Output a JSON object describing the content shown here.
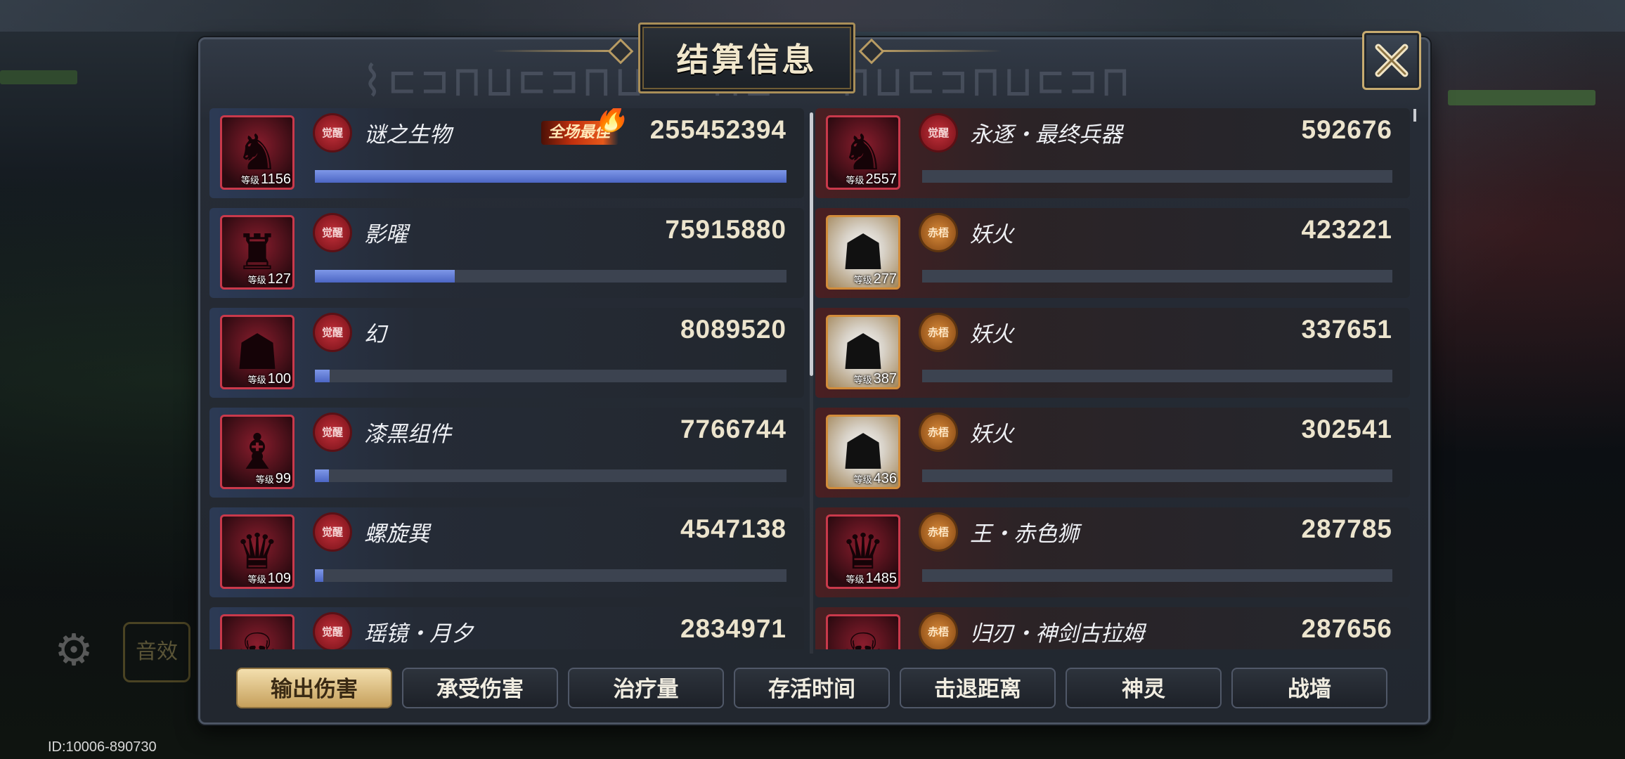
{
  "player_id": "ID:10006-890730",
  "dialog": {
    "title": "结算信息",
    "close_label": "close"
  },
  "background": {
    "gear_icon": "gear-icon",
    "side_button_label": "音效"
  },
  "left_team": [
    {
      "name": "谜之生物",
      "level_label": "等级",
      "level": "1156",
      "value": "255452394",
      "progress": 1.0,
      "badge": "觉醒",
      "mvp": "全场最佳"
    },
    {
      "name": "影曜",
      "level_label": "等级",
      "level": "127",
      "value": "75915880",
      "progress": 0.297,
      "badge": "觉醒"
    },
    {
      "name": "幻",
      "level_label": "等级",
      "level": "100",
      "value": "8089520",
      "progress": 0.032,
      "badge": "觉醒"
    },
    {
      "name": "漆黑组件",
      "level_label": "等级",
      "level": "99",
      "value": "7766744",
      "progress": 0.03,
      "badge": "觉醒"
    },
    {
      "name": "螺旋巽",
      "level_label": "等级",
      "level": "109",
      "value": "4547138",
      "progress": 0.018,
      "badge": "觉醒"
    },
    {
      "name": "瑶镜・月夕",
      "level_label": "等级",
      "level": "",
      "value": "2834971",
      "progress": 0.011,
      "badge": "觉醒"
    }
  ],
  "right_team": [
    {
      "name": "永逐・最终兵器",
      "level_label": "等级",
      "level": "2557",
      "value": "592676",
      "progress": 0.0,
      "badge": "觉醒",
      "style": "red"
    },
    {
      "name": "妖火",
      "level_label": "等级",
      "level": "277",
      "value": "423221",
      "progress": 0.0,
      "badge": "赤梧",
      "style": "gold"
    },
    {
      "name": "妖火",
      "level_label": "等级",
      "level": "387",
      "value": "337651",
      "progress": 0.0,
      "badge": "赤梧",
      "style": "gold"
    },
    {
      "name": "妖火",
      "level_label": "等级",
      "level": "436",
      "value": "302541",
      "progress": 0.0,
      "badge": "赤梧",
      "style": "gold"
    },
    {
      "name": "王・赤色狮",
      "level_label": "等级",
      "level": "1485",
      "value": "287785",
      "progress": 0.0,
      "badge": "赤梧",
      "style": "red"
    },
    {
      "name": "归刃・神剑古拉姆",
      "level_label": "等级",
      "level": "",
      "value": "287656",
      "progress": 0.0,
      "badge": "赤梧",
      "style": "red"
    }
  ],
  "tabs": [
    {
      "label": "输出伤害",
      "active": true
    },
    {
      "label": "承受伤害",
      "active": false
    },
    {
      "label": "治疗量",
      "active": false
    },
    {
      "label": "存活时间",
      "active": false
    },
    {
      "label": "击退距离",
      "active": false
    },
    {
      "label": "神灵",
      "active": false
    },
    {
      "label": "战墙",
      "active": false
    }
  ],
  "colors": {
    "accent_gold": "#c7ab70",
    "bar_blue": "#5d78d8",
    "left_row_tint": "#2c3a55",
    "right_row_tint": "#4a1f22",
    "tab_active": "#e3c88a"
  }
}
